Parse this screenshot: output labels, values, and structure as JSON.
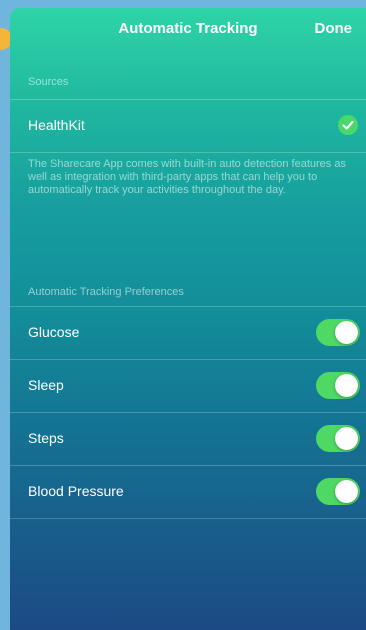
{
  "nav": {
    "title": "Automatic Tracking",
    "done_label": "Done"
  },
  "sources": {
    "header": "Sources",
    "items": [
      {
        "label": "HealthKit",
        "checked": true,
        "icon": "checkmark-icon"
      }
    ],
    "description": "The Sharecare App comes with built-in auto detection features as well as integration with third-party apps that can help you to automatically track your activities throughout the day."
  },
  "preferences": {
    "header": "Automatic Tracking Preferences",
    "items": [
      {
        "label": "Glucose",
        "enabled": true
      },
      {
        "label": "Sleep",
        "enabled": true
      },
      {
        "label": "Steps",
        "enabled": true
      },
      {
        "label": "Blood Pressure",
        "enabled": true
      }
    ]
  },
  "colors": {
    "toggle_on": "#4dd964",
    "check_green": "#48d96a",
    "gradient_top": "#2fd4a7",
    "gradient_bottom": "#1c4a84"
  }
}
